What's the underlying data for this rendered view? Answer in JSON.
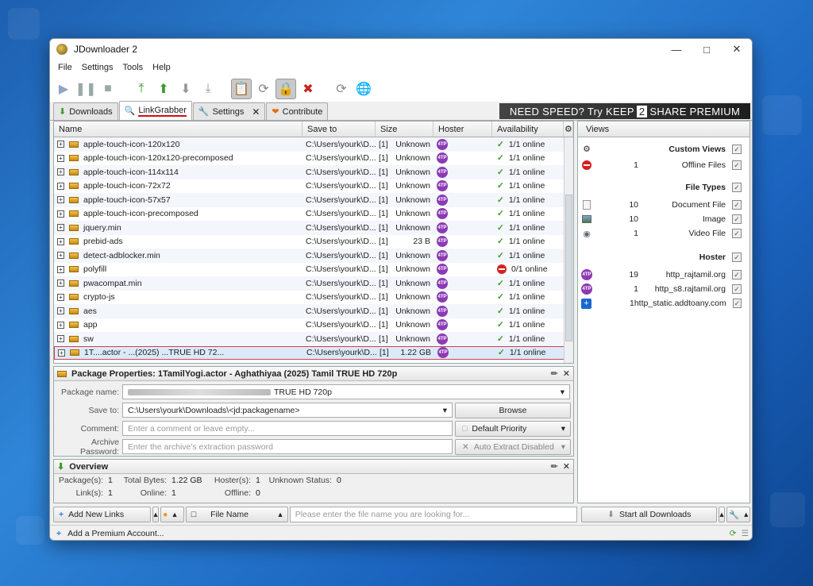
{
  "window": {
    "title": "JDownloader 2",
    "controls": [
      "minimize-icon",
      "maximize-icon",
      "close-icon"
    ]
  },
  "menu": [
    "File",
    "Settings",
    "Tools",
    "Help"
  ],
  "tabs": [
    {
      "label": "Downloads",
      "icon": "arrow-down-icon"
    },
    {
      "label": "LinkGrabber",
      "icon": "linkgrabber-icon",
      "active": true
    },
    {
      "label": "Settings",
      "icon": "wrench-icon"
    },
    {
      "label": "Contribute",
      "icon": "heart-icon"
    }
  ],
  "banner": {
    "pre": "NEED SPEED? Try KEEP",
    "num": "2",
    "post": "SHARE PREMIUM"
  },
  "grid": {
    "headers": {
      "name": "Name",
      "save": "Save to",
      "size": "Size",
      "hoster": "Hoster",
      "availability": "Availability"
    },
    "rows": [
      {
        "name": "apple-touch-icon-120x120",
        "save": "C:\\Users\\yourk\\D...",
        "count": "[1]",
        "size": "Unknown",
        "av": "1/1 online",
        "status": "ok"
      },
      {
        "name": "apple-touch-icon-120x120-precomposed",
        "save": "C:\\Users\\yourk\\D...",
        "count": "[1]",
        "size": "Unknown",
        "av": "1/1 online",
        "status": "ok"
      },
      {
        "name": "apple-touch-icon-114x114",
        "save": "C:\\Users\\yourk\\D...",
        "count": "[1]",
        "size": "Unknown",
        "av": "1/1 online",
        "status": "ok"
      },
      {
        "name": "apple-touch-icon-72x72",
        "save": "C:\\Users\\yourk\\D...",
        "count": "[1]",
        "size": "Unknown",
        "av": "1/1 online",
        "status": "ok"
      },
      {
        "name": "apple-touch-icon-57x57",
        "save": "C:\\Users\\yourk\\D...",
        "count": "[1]",
        "size": "Unknown",
        "av": "1/1 online",
        "status": "ok"
      },
      {
        "name": "apple-touch-icon-precomposed",
        "save": "C:\\Users\\yourk\\D...",
        "count": "[1]",
        "size": "Unknown",
        "av": "1/1 online",
        "status": "ok"
      },
      {
        "name": "jquery.min",
        "save": "C:\\Users\\yourk\\D...",
        "count": "[1]",
        "size": "Unknown",
        "av": "1/1 online",
        "status": "ok"
      },
      {
        "name": "prebid-ads",
        "save": "C:\\Users\\yourk\\D...",
        "count": "[1]",
        "size": "23 B",
        "av": "1/1 online",
        "status": "ok"
      },
      {
        "name": "detect-adblocker.min",
        "save": "C:\\Users\\yourk\\D...",
        "count": "[1]",
        "size": "Unknown",
        "av": "1/1 online",
        "status": "ok"
      },
      {
        "name": "polyfill",
        "save": "C:\\Users\\yourk\\D...",
        "count": "[1]",
        "size": "Unknown",
        "av": "0/1 online",
        "status": "bad"
      },
      {
        "name": "pwacompat.min",
        "save": "C:\\Users\\yourk\\D...",
        "count": "[1]",
        "size": "Unknown",
        "av": "1/1 online",
        "status": "ok"
      },
      {
        "name": "crypto-js",
        "save": "C:\\Users\\yourk\\D...",
        "count": "[1]",
        "size": "Unknown",
        "av": "1/1 online",
        "status": "ok"
      },
      {
        "name": "aes",
        "save": "C:\\Users\\yourk\\D...",
        "count": "[1]",
        "size": "Unknown",
        "av": "1/1 online",
        "status": "ok"
      },
      {
        "name": "app",
        "save": "C:\\Users\\yourk\\D...",
        "count": "[1]",
        "size": "Unknown",
        "av": "1/1 online",
        "status": "ok"
      },
      {
        "name": "sw",
        "save": "C:\\Users\\yourk\\D...",
        "count": "[1]",
        "size": "Unknown",
        "av": "1/1 online",
        "status": "ok"
      },
      {
        "name": "1T....actor - ...(2025) ...TRUE HD 72...",
        "save": "C:\\Users\\yourk\\D...",
        "count": "[1]",
        "size": "1.22 GB",
        "av": "1/1 online",
        "status": "ok",
        "selected": true
      }
    ]
  },
  "views": {
    "title": "Views",
    "custom_views": "Custom Views",
    "offline": {
      "count": "1",
      "label": "Offline Files"
    },
    "file_types": "File Types",
    "types": [
      {
        "count": "10",
        "label": "Document File",
        "icon": "document-icon"
      },
      {
        "count": "10",
        "label": "Image",
        "icon": "image-icon"
      },
      {
        "count": "1",
        "label": "Video File",
        "icon": "video-icon"
      }
    ],
    "hoster": "Hoster",
    "hosters": [
      {
        "count": "19",
        "label": "http_rajtamil.org",
        "icon": "hoster-icon"
      },
      {
        "count": "1",
        "label": "http_s8.rajtamil.org",
        "icon": "hoster-icon"
      },
      {
        "count": "1",
        "label": "http_static.addtoany.com",
        "icon": "addtoany-icon"
      }
    ]
  },
  "props": {
    "title": "Package Properties: 1TamilYogi.actor - Aghathiyaa (2025) Tamil TRUE HD 720p",
    "package_name_label": "Package name:",
    "package_name_value": "TRUE HD 720p",
    "save_to_label": "Save to:",
    "save_to_value": "C:\\Users\\yourk\\Downloads\\<jd:packagename>",
    "browse": "Browse",
    "comment_label": "Comment:",
    "comment_placeholder": "Enter a comment or leave empty...",
    "priority": "Default Priority",
    "archive_label": "Archive Password:",
    "archive_placeholder": "Enter the archive's extraction password",
    "auto_extract": "Auto Extract Disabled"
  },
  "overview": {
    "title": "Overview",
    "packages_label": "Package(s):",
    "packages": "1",
    "bytes_label": "Total Bytes:",
    "bytes": "1.22 GB",
    "hosters_label": "Hoster(s):",
    "hosters": "1",
    "unknown_label": "Unknown Status:",
    "unknown": "0",
    "links_label": "Link(s):",
    "links": "1",
    "online_label": "Online:",
    "online": "1",
    "offline_label": "Offline:",
    "offline": "0"
  },
  "bottom": {
    "add_links": "Add New Links",
    "file_name": "File Name",
    "search_placeholder": "Please enter the file name you are looking for...",
    "start_all": "Start all Downloads"
  },
  "status": {
    "add_premium": "Add a Premium Account..."
  },
  "colors": {
    "accent": "#2b7fd8",
    "hoster": "#8b3ab4",
    "offline": "#d81e1e",
    "online": "#3a9a2a"
  }
}
